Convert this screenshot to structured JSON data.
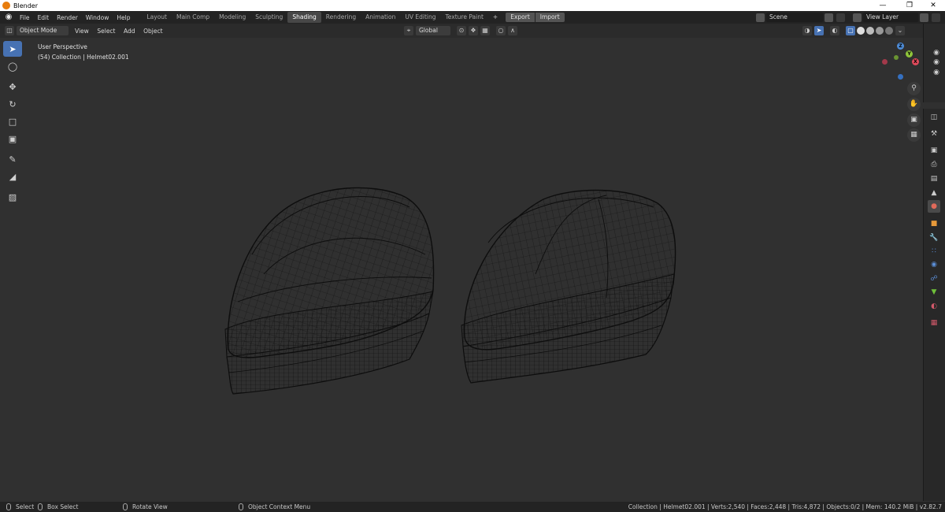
{
  "window": {
    "title": "Blender",
    "controls": [
      "—",
      "❐",
      "✕"
    ]
  },
  "menu": [
    "File",
    "Edit",
    "Render",
    "Window",
    "Help"
  ],
  "workspaces": [
    "Layout",
    "Main Comp",
    "Modeling",
    "Sculpting",
    "Shading",
    "Rendering",
    "Animation",
    "UV Editing",
    "Texture Paint",
    "+"
  ],
  "active_workspace": "Shading",
  "export_label": "Export",
  "import_label": "Import",
  "scene": "Scene",
  "view_layer": "View Layer",
  "viewport": {
    "mode": "Object Mode",
    "menus": [
      "View",
      "Select",
      "Add",
      "Object"
    ],
    "transform_orientation": "Global",
    "perspective": "User Perspective",
    "collection_info": "(54) Collection | Helmet02.001"
  },
  "gizmo": {
    "z": "Z",
    "y": "Y",
    "x": "X"
  },
  "status": {
    "select": "Select",
    "box_select": "Box Select",
    "rotate_view": "Rotate View",
    "context_menu": "Object Context Menu",
    "stats": "Collection | Helmet02.001 | Verts:2,540 | Faces:2,448 | Tris:4,872 | Objects:0/2 | Mem: 140.2 MiB | v2.82.7"
  },
  "colors": {
    "active": "#4772b3",
    "bg": "#303030",
    "header": "#232323",
    "wire": "#111111"
  }
}
